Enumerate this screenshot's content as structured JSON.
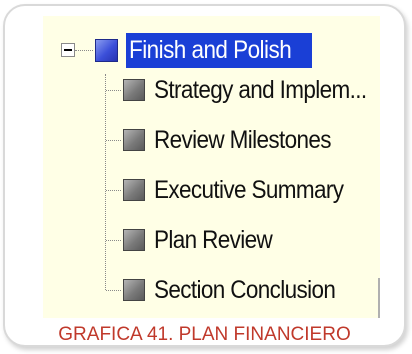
{
  "tree": {
    "root": {
      "label": "Finish and Polish",
      "expanded": true,
      "selected": true,
      "icon": "blue-section-icon"
    },
    "children": [
      {
        "label": "Strategy and Implem...",
        "icon": "gray-section-icon"
      },
      {
        "label": "Review Milestones",
        "icon": "gray-section-icon"
      },
      {
        "label": "Executive Summary",
        "icon": "gray-section-icon"
      },
      {
        "label": "Plan Review",
        "icon": "gray-section-icon"
      },
      {
        "label": "Section Conclusion",
        "icon": "gray-section-icon"
      }
    ]
  },
  "caption": "GRAFICA 41. PLAN FINANCIERO",
  "colors": {
    "panel_background": "#ffffe6",
    "selection": "#1a3fd6",
    "caption": "#c0392b",
    "card_border": "#d9d9d9"
  }
}
